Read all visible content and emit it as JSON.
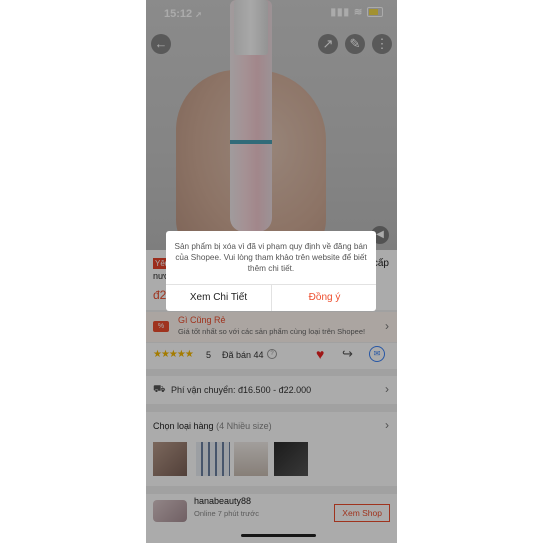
{
  "status_bar": {
    "time": "15:12",
    "location_arrow": "➚"
  },
  "product": {
    "tag": "Yêu",
    "title_line1": "nướ",
    "title_tail": "cấp",
    "price": "đ2"
  },
  "gi_cung_re": {
    "title": "Gì Cũng Rẻ",
    "subtitle": "Giá tốt nhất so với các sản phẩm cùng loại trên Shopee!"
  },
  "rating": {
    "stars": "★★★★★",
    "score": "5",
    "sold": "Đã bán 44"
  },
  "shipping": {
    "label": "Phí vận chuyển: đ16.500 - đ22.000"
  },
  "variants": {
    "title": "Chọn loại hàng",
    "count_note": "(4 Nhiều size)"
  },
  "shop": {
    "name": "hanabeauty88",
    "online": "Online 7 phút trước",
    "button": "Xem Shop"
  },
  "dialog": {
    "message": "Sản phẩm bị xóa vì đã vi phạm quy định về đăng bán của Shopee. Vui lòng tham khảo trên website để biết thêm chi tiết.",
    "left_button": "Xem Chi Tiết",
    "right_button": "Đồng ý"
  },
  "icons": {
    "back": "back-arrow-icon",
    "share": "share-icon",
    "edit": "edit-icon",
    "more": "more-icon",
    "mute": "volume-icon",
    "heart": "heart-icon",
    "messenger": "messenger-icon",
    "truck": "truck-icon"
  },
  "colors": {
    "accent": "#ee4d2d",
    "star": "#f5b800",
    "overlay": "rgba(0,0,0,0.33)"
  }
}
